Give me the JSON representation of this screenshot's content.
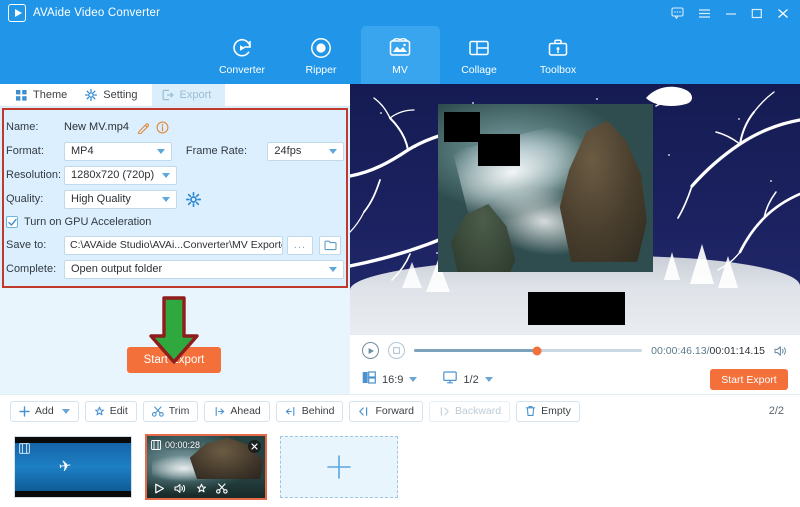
{
  "titlebar": {
    "app_name": "AVAide Video Converter",
    "logo_icon": "play-logo-icon",
    "controls": [
      {
        "name": "feedback-icon",
        "label": "feedback"
      },
      {
        "name": "menu-icon",
        "label": "menu"
      },
      {
        "name": "minimize-icon",
        "label": "minimize"
      },
      {
        "name": "maximize-icon",
        "label": "maximize"
      },
      {
        "name": "close-icon",
        "label": "close"
      }
    ]
  },
  "nav": {
    "items": [
      {
        "label": "Converter",
        "icon": "convert-refresh-icon",
        "active": false
      },
      {
        "label": "Ripper",
        "icon": "disc-record-icon",
        "active": false
      },
      {
        "label": "MV",
        "icon": "mv-image-icon",
        "active": true
      },
      {
        "label": "Collage",
        "icon": "collage-grid-icon",
        "active": false
      },
      {
        "label": "Toolbox",
        "icon": "toolbox-case-icon",
        "active": false
      }
    ]
  },
  "subtabs": [
    {
      "label": "Theme",
      "icon": "theme-squares-icon",
      "active": false
    },
    {
      "label": "Setting",
      "icon": "setting-gear-icon",
      "active": false
    },
    {
      "label": "Export",
      "icon": "export-arrow-icon",
      "active": true
    }
  ],
  "export_form": {
    "name_label": "Name:",
    "name_value": "New MV.mp4",
    "edit_icon": "pencil-edit-icon",
    "info_icon": "info-circle-icon",
    "format_label": "Format:",
    "format_value": "MP4",
    "frame_rate_label": "Frame Rate:",
    "frame_rate_value": "24fps",
    "resolution_label": "Resolution:",
    "resolution_value": "1280x720 (720p)",
    "quality_label": "Quality:",
    "quality_value": "High Quality",
    "quality_gear_icon": "settings-gear-icon",
    "gpu_label": "Turn on GPU Acceleration",
    "gpu_checked": true,
    "save_to_label": "Save to:",
    "save_to_value": "C:\\AVAide Studio\\AVAi...Converter\\MV Exported",
    "browse_label": "...",
    "folder_icon": "folder-open-icon",
    "complete_label": "Complete:",
    "complete_value": "Open output folder"
  },
  "export_action": {
    "button_label": "Start Export",
    "arrow_icon": "green-down-arrow-annotation",
    "arrow_fill": "#2fa83e",
    "arrow_stroke": "#8f1d1d",
    "button_color": "#f4703a"
  },
  "annotation": {
    "box_color": "#c0392b"
  },
  "player": {
    "play_icon": "play-circle-icon",
    "stop_icon": "stop-square-icon",
    "current_time": "00:00:46.13",
    "separator": "/",
    "total_time": "00:01:14.15",
    "volume_icon": "volume-speaker-icon",
    "aspect_icon": "aspect-ratio-icon",
    "aspect_value": "16:9",
    "zoom_icon": "monitor-screen-icon",
    "zoom_value": "1/2",
    "start_export_label": "Start Export",
    "progress_percent": 54
  },
  "toolbar": {
    "buttons": [
      {
        "label": "Add",
        "icon": "plus-icon",
        "has_caret": true,
        "disabled": false
      },
      {
        "label": "Edit",
        "icon": "edit-star-icon",
        "has_caret": false,
        "disabled": false
      },
      {
        "label": "Trim",
        "icon": "scissors-icon",
        "has_caret": false,
        "disabled": false
      },
      {
        "label": "Ahead",
        "icon": "insert-ahead-icon",
        "has_caret": false,
        "disabled": false
      },
      {
        "label": "Behind",
        "icon": "insert-behind-icon",
        "has_caret": false,
        "disabled": false
      },
      {
        "label": "Forward",
        "icon": "move-forward-icon",
        "has_caret": false,
        "disabled": false
      },
      {
        "label": "Backward",
        "icon": "move-backward-icon",
        "has_caret": false,
        "disabled": true
      },
      {
        "label": "Empty",
        "icon": "trash-icon",
        "has_caret": false,
        "disabled": false
      }
    ],
    "pager": "2/2"
  },
  "thumbnails": {
    "items": [
      {
        "name": "clip-airplane",
        "selected": false,
        "duration": "",
        "badge_icon": "film-strip-icon"
      },
      {
        "name": "clip-coast",
        "selected": true,
        "duration": "00:00:28",
        "badge_icon": "film-strip-icon"
      }
    ],
    "add_label": "+",
    "clip_controls": [
      {
        "icon": "play-icon"
      },
      {
        "icon": "volume-icon"
      },
      {
        "icon": "edit-icon"
      },
      {
        "icon": "trim-scissors-icon"
      }
    ],
    "close_icon": "remove-clip-icon"
  }
}
